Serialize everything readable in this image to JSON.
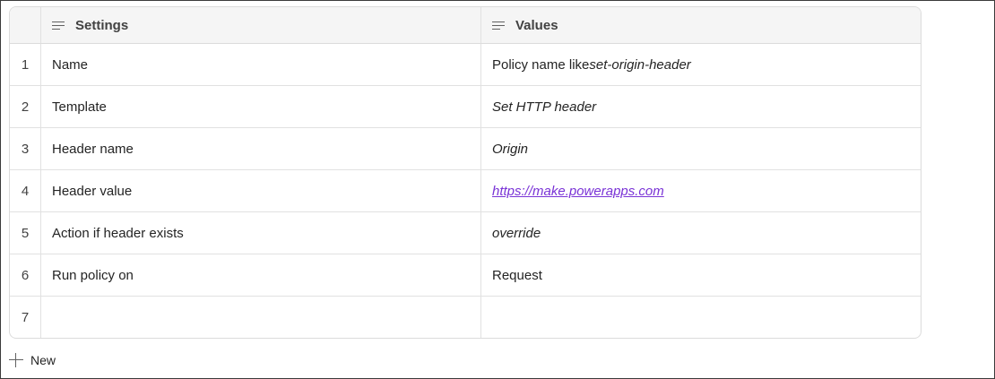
{
  "table": {
    "headers": {
      "settings": "Settings",
      "values": "Values"
    },
    "rows": [
      {
        "num": "1",
        "setting": "Name",
        "value_prefix": "Policy name like ",
        "value_emph": "set-origin-header"
      },
      {
        "num": "2",
        "setting": "Template",
        "value_emph": "Set HTTP header"
      },
      {
        "num": "3",
        "setting": "Header name",
        "value_emph": "Origin"
      },
      {
        "num": "4",
        "setting": "Header value",
        "value_link": "https://make.powerapps.com"
      },
      {
        "num": "5",
        "setting": "Action if header exists",
        "value_emph": "override"
      },
      {
        "num": "6",
        "setting": "Run policy on",
        "value_plain": "Request"
      },
      {
        "num": "7",
        "setting": "",
        "value_plain": ""
      }
    ]
  },
  "new_button": {
    "label": "New"
  },
  "colors": {
    "link": "#7a33d6",
    "header_bg": "#f5f5f5",
    "border": "#e1e1e1"
  }
}
